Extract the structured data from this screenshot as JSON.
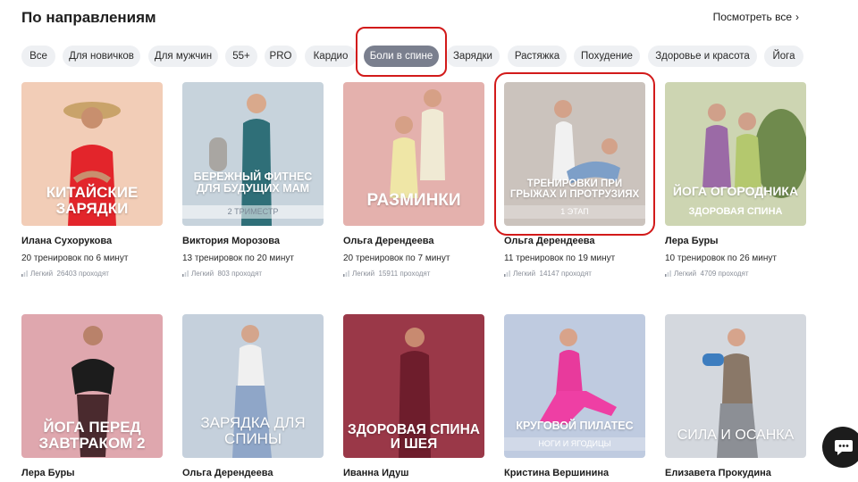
{
  "section": {
    "title": "По направлениям",
    "see_all": "Посмотреть все"
  },
  "filters": [
    "Все",
    "Для новичков",
    "Для мужчин",
    "55+",
    "PRO",
    "Кардио",
    "Боли в спине",
    "Зарядки",
    "Растяжка",
    "Похудение",
    "Здоровье и красота",
    "Йога"
  ],
  "active_filter": "Боли в спине",
  "colors": {
    "active_chip": "#7a7f8e",
    "chip": "#eef0f3",
    "highlight": "#d21a1a"
  },
  "cards": [
    {
      "overlay": "КИТАЙСКИЕ ЗАРЯДКИ",
      "sub": "",
      "author": "Илана Сухорукова",
      "count": "20 тренировок по 6 минут",
      "level": "Легкий",
      "passing": "26403 проходят",
      "bg": "#f2cdb7"
    },
    {
      "overlay": "БЕРЕЖНЫЙ ФИТНЕС ДЛЯ БУДУЩИХ МАМ",
      "sub": "2 ТРИМЕСТР",
      "author": "Виктория Морозова",
      "count": "13 тренировок по 20 минут",
      "level": "Легкий",
      "passing": "803 проходят",
      "bg": "#c7d3dc"
    },
    {
      "overlay": "РАЗМИНКИ",
      "sub": "",
      "author": "Ольга Дерендеева",
      "count": "20 тренировок по 7 минут",
      "level": "Легкий",
      "passing": "15911 проходят",
      "bg": "#e4b1ad"
    },
    {
      "overlay": "ТРЕНИРОВКИ ПРИ ГРЫЖАХ И ПРОТРУЗИЯХ",
      "sub": "1 ЭТАП",
      "author": "Ольга Дерендеева",
      "count": "11 тренировок по 19 минут",
      "level": "Легкий",
      "passing": "14147 проходят",
      "bg": "#cbc3bd"
    },
    {
      "overlay": "ЙОГА ОГОРОДНИКА",
      "sub": "ЗДОРОВАЯ СПИНА",
      "author": "Лера Буры",
      "count": "10 тренировок по 26 минут",
      "level": "Легкий",
      "passing": "4709 проходят",
      "bg": "#cdd5b2"
    },
    {
      "overlay": "ЙОГА ПЕРЕД ЗАВТРАКОМ 2",
      "sub": "",
      "author": "Лера Буры",
      "count": "",
      "level": "",
      "passing": "",
      "bg": "#dfa7ae"
    },
    {
      "overlay": "ЗАРЯДКА ДЛЯ СПИНЫ",
      "sub": "",
      "author": "Ольга Дерендеева",
      "count": "",
      "level": "",
      "passing": "",
      "bg": "#c5d0dc"
    },
    {
      "overlay": "ЗДОРОВАЯ СПИНА И ШЕЯ",
      "sub": "",
      "author": "Иванна Идуш",
      "count": "",
      "level": "",
      "passing": "",
      "bg": "#9a3848"
    },
    {
      "overlay": "КРУГОВОЙ ПИЛАТЕС",
      "sub": "НОГИ И ЯГОДИЦЫ",
      "author": "Кристина Вершинина",
      "count": "",
      "level": "",
      "passing": "",
      "bg": "#bfcbe0"
    },
    {
      "overlay": "СИЛА И ОСАНКА",
      "sub": "",
      "author": "Елизавета Прокудина",
      "count": "",
      "level": "",
      "passing": "",
      "bg": "#d4d8de"
    }
  ]
}
